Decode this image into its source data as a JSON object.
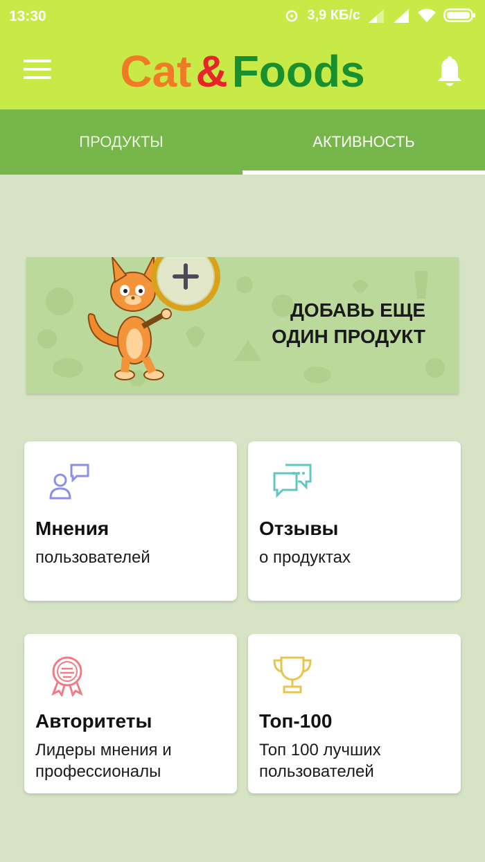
{
  "status_bar": {
    "time": "13:30",
    "speed": "3,9 КБ/с",
    "icons": [
      "signal-icon",
      "signal-icon",
      "wifi-icon",
      "battery-icon"
    ]
  },
  "app_bar": {
    "logo": {
      "cat": "Cat",
      "amp": "&",
      "foods": "Foods"
    },
    "colors": {
      "cat": "#f07b27",
      "amp": "#e8232a",
      "foods": "#19902f",
      "bar": "#c7ea46"
    }
  },
  "tabs": [
    {
      "label": "ПРОДУКТЫ",
      "active": false
    },
    {
      "label": "АКТИВНОСТЬ",
      "active": true
    }
  ],
  "promo": {
    "line1": "ДОБАВЬ ЕЩЕ",
    "line2": "ОДИН ПРОДУКТ"
  },
  "cards": [
    {
      "title": "Мнения",
      "subtitle": "пользователей",
      "icon": "user-chat-icon"
    },
    {
      "title": "Отзывы",
      "subtitle": "о продуктах",
      "icon": "chat-bubbles-icon"
    },
    {
      "title": "Авторитеты",
      "subtitle": "Лидеры мнения и профессионалы",
      "icon": "badge-icon"
    },
    {
      "title": "Топ-100",
      "subtitle": "Топ 100 лучших пользователей",
      "icon": "trophy-icon"
    }
  ]
}
